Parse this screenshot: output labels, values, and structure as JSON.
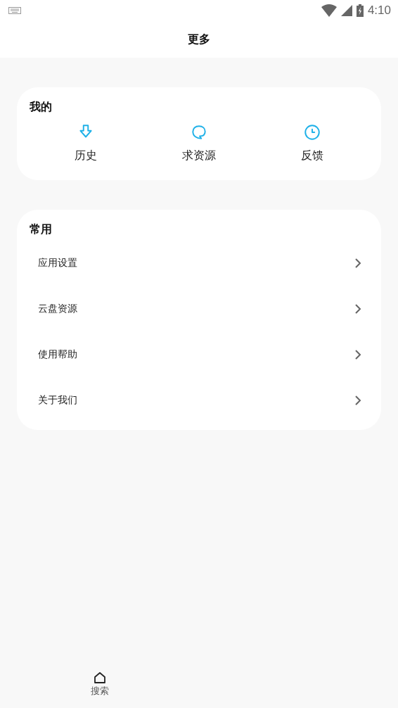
{
  "status_bar": {
    "time": "4:10"
  },
  "header": {
    "title": "更多"
  },
  "mine": {
    "title": "我的",
    "items": [
      {
        "label": "历史",
        "kind": "download"
      },
      {
        "label": "求资源",
        "kind": "chat"
      },
      {
        "label": "反馈",
        "kind": "clock"
      }
    ]
  },
  "common": {
    "title": "常用",
    "items": [
      {
        "label": "应用设置"
      },
      {
        "label": "云盘资源"
      },
      {
        "label": "使用帮助"
      },
      {
        "label": "关于我们"
      }
    ]
  },
  "bottom_nav": [
    {
      "label": "搜索",
      "selected": false
    }
  ]
}
